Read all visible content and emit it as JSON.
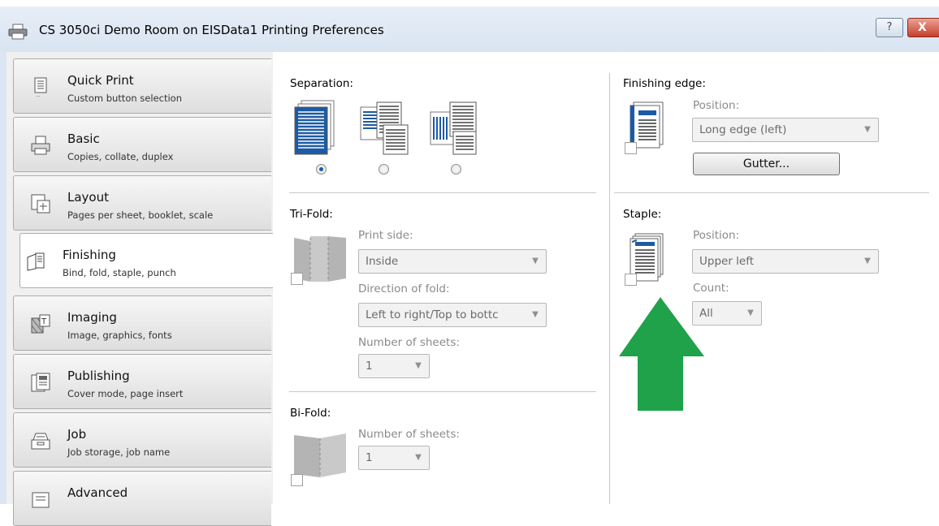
{
  "window": {
    "title": "CS 3050ci Demo Room on EISData1 Printing Preferences",
    "help_label": "?",
    "close_label": "X"
  },
  "sidebar": {
    "items": [
      {
        "name": "Quick Print",
        "desc": "Custom button selection"
      },
      {
        "name": "Basic",
        "desc": "Copies, collate, duplex"
      },
      {
        "name": "Layout",
        "desc": "Pages per sheet, booklet, scale"
      },
      {
        "name": "Finishing",
        "desc": "Bind, fold, staple, punch",
        "active": true
      },
      {
        "name": "Imaging",
        "desc": "Image, graphics, fonts"
      },
      {
        "name": "Publishing",
        "desc": "Cover mode, page insert"
      },
      {
        "name": "Job",
        "desc": "Job storage, job name"
      },
      {
        "name": "Advanced",
        "desc": ""
      }
    ]
  },
  "separation": {
    "label": "Separation:",
    "selected_index": 0
  },
  "trifold": {
    "label": "Tri-Fold:",
    "print_side_label": "Print side:",
    "print_side_value": "Inside",
    "direction_label": "Direction of fold:",
    "direction_value": "Left to right/Top to bottc",
    "sheets_label": "Number of sheets:",
    "sheets_value": "1"
  },
  "bifold": {
    "label": "Bi-Fold:",
    "sheets_label": "Number of sheets:",
    "sheets_value": "1"
  },
  "finishing_edge": {
    "label": "Finishing edge:",
    "position_label": "Position:",
    "position_value": "Long edge (left)",
    "gutter_label": "Gutter..."
  },
  "staple": {
    "label": "Staple:",
    "position_label": "Position:",
    "position_value": "Upper left",
    "count_label": "Count:",
    "count_value": "All"
  },
  "colors": {
    "accent_blue": "#1d5aa4",
    "arrow_green": "#1fa24a"
  }
}
